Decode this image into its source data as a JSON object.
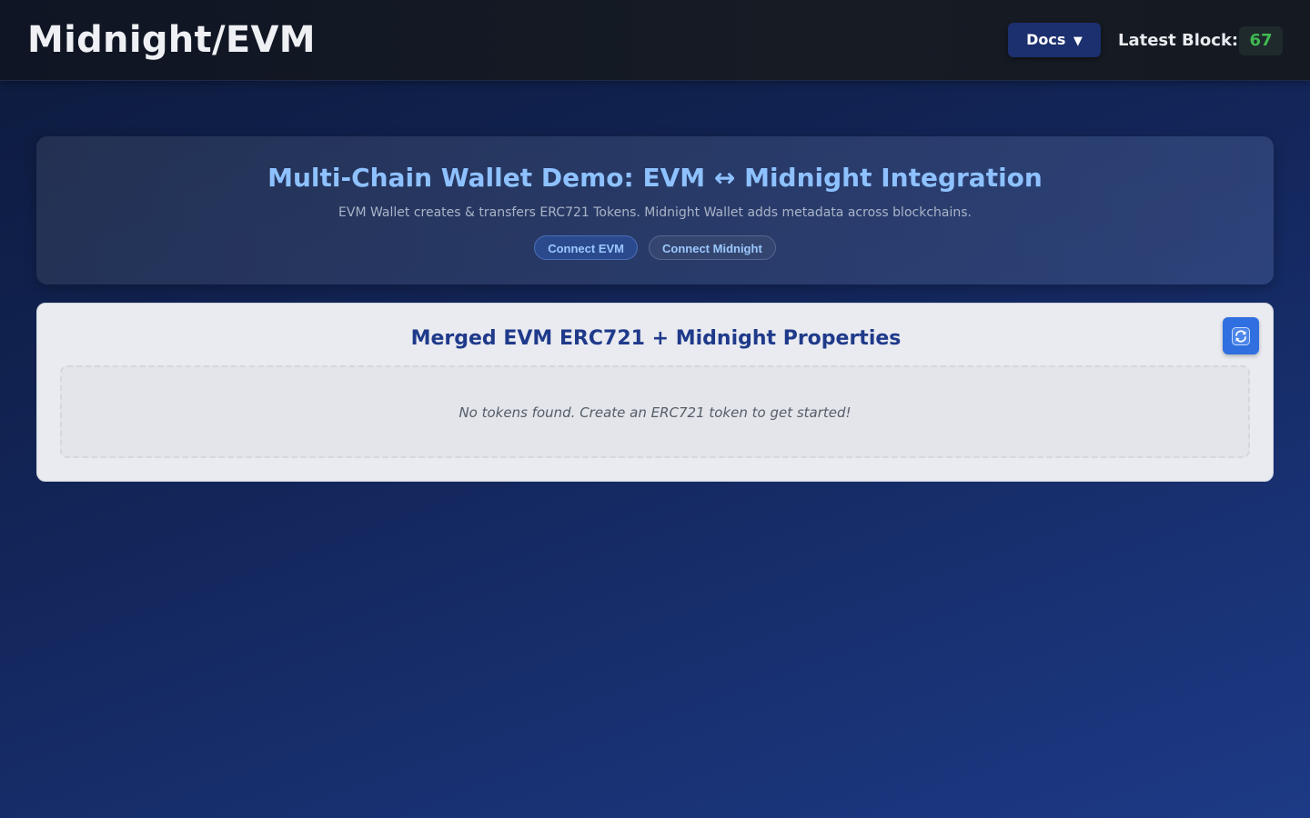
{
  "header": {
    "brand": "Midnight/EVM",
    "docs_label": "Docs",
    "docs_caret": "▼",
    "latest_block_label": "Latest Block:",
    "latest_block_value": "67"
  },
  "hero": {
    "title": "Multi-Chain Wallet Demo: EVM ↔ Midnight Integration",
    "subtitle": "EVM Wallet creates & transfers ERC721 Tokens. Midnight Wallet adds metadata across blockchains.",
    "connect_evm_label": "Connect EVM",
    "connect_midnight_label": "Connect Midnight"
  },
  "tokens_panel": {
    "title": "Merged EVM ERC721 + Midnight Properties",
    "refresh_icon": "refresh-icon",
    "empty_message": "No tokens found. Create an ERC721 token to get started!"
  },
  "colors": {
    "accent_blue": "#2f6fe0",
    "block_number_green": "#3fb950",
    "hero_title": "#8ec1ff",
    "panel_title": "#1f3a8a"
  }
}
